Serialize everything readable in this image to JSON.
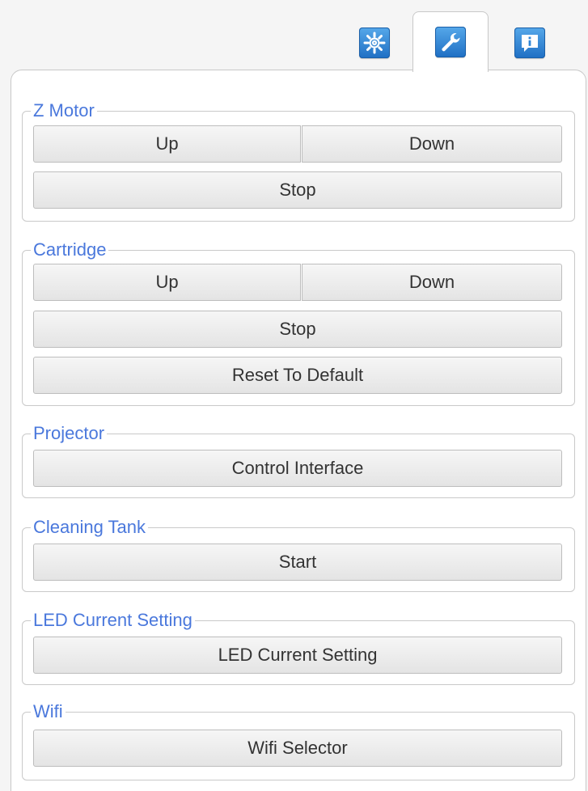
{
  "tabs": [
    {
      "icon": "gear-icon",
      "active": false
    },
    {
      "icon": "wrench-icon",
      "active": true
    },
    {
      "icon": "info-icon",
      "active": false
    }
  ],
  "colors": {
    "legend": "#4a78dc",
    "tab_icon": "#2f86d8",
    "button_text": "#333333"
  },
  "groups": {
    "z_motor": {
      "legend": "Z Motor",
      "up": "Up",
      "down": "Down",
      "stop": "Stop"
    },
    "cartridge": {
      "legend": "Cartridge",
      "up": "Up",
      "down": "Down",
      "stop": "Stop",
      "reset": "Reset To Default"
    },
    "projector": {
      "legend": "Projector",
      "control": "Control Interface"
    },
    "cleaning_tank": {
      "legend": "Cleaning Tank",
      "start": "Start"
    },
    "led": {
      "legend": "LED Current Setting",
      "button": "LED Current Setting"
    },
    "wifi": {
      "legend": "Wifi",
      "button": "Wifi Selector"
    }
  }
}
